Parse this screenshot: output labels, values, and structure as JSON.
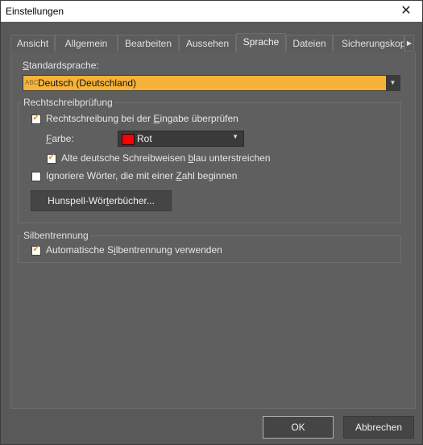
{
  "window": {
    "title": "Einstellungen",
    "close_symbol": "✕"
  },
  "tabs": [
    {
      "label": "Ansicht",
      "active": false
    },
    {
      "label": "Allgemein",
      "active": false
    },
    {
      "label": "Bearbeiten",
      "active": false
    },
    {
      "label": "Aussehen",
      "active": false
    },
    {
      "label": "Sprache",
      "active": true
    },
    {
      "label": "Dateien",
      "active": false
    },
    {
      "label": "Sicherungskop",
      "active": false
    }
  ],
  "tab_scroll_icon": "chevron-right-icon",
  "language": {
    "label_accel": "S",
    "label_rest": "tandardsprache:",
    "value": "Deutsch (Deutschland)",
    "flag_text": "ABC",
    "highlight_color": "#f6b33a"
  },
  "spelling": {
    "legend": "Rechtschreibprüfung",
    "check_pre": "Rechtschreibung bei der ",
    "check_accel": "E",
    "check_post": "ingabe überprüfen",
    "check_checked": true,
    "color_label_accel": "F",
    "color_label_rest": "arbe:",
    "color_value": "Rot",
    "color_hex": "#ff0000",
    "old_pre": "Alte deutsche Schreibweisen ",
    "old_accel": "b",
    "old_post": "lau unterstreichen",
    "old_checked": true,
    "ignore_pre": "Ignoriere Wörter, die mit einer ",
    "ignore_accel": "Z",
    "ignore_post": "ahl beginnen",
    "ignore_checked": false,
    "hunspell_pre": "Hunspell-Wör",
    "hunspell_accel": "t",
    "hunspell_post": "erbücher..."
  },
  "hyphenation": {
    "legend": "Silbentrennung",
    "auto_pre": "Automatische S",
    "auto_accel": "i",
    "auto_post": "lbentrennung verwenden",
    "auto_checked": true
  },
  "footer": {
    "ok_label": "OK",
    "cancel_label": "Abbrechen"
  },
  "check_mark": "✓"
}
